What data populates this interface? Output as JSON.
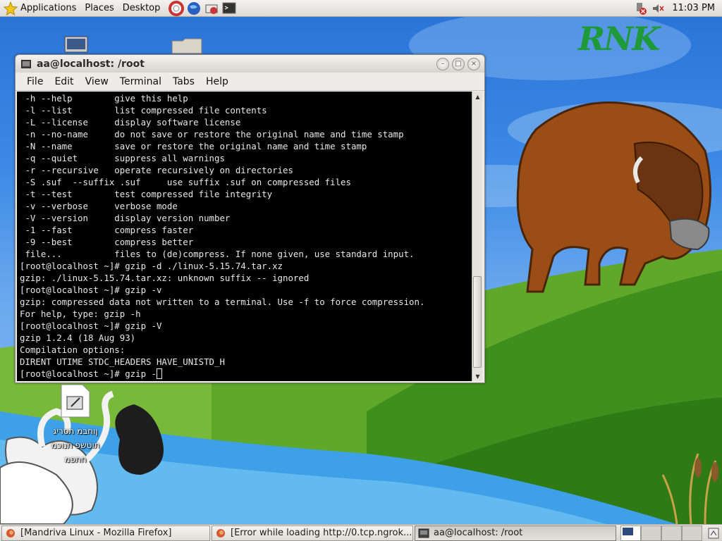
{
  "top_panel": {
    "menus": [
      "Applications",
      "Places",
      "Desktop"
    ],
    "launchers": [
      "help-icon",
      "web-browser-icon",
      "mail-icon",
      "terminal-icon"
    ],
    "clock": "11:03 PM",
    "tray": [
      "network-icon",
      "volume-muted-icon"
    ]
  },
  "desktop": {
    "logo_text": "RNK",
    "icons": [
      {
        "name": "computer-icon",
        "label": ""
      },
      {
        "name": "folder-icon",
        "label": ""
      },
      {
        "name": "document-icon",
        "label": "ןוחבמ תסריג\nתוטשפ תנוכמ\nחתפמ"
      }
    ]
  },
  "terminal": {
    "title": "aa@localhost: /root",
    "menu": [
      "File",
      "Edit",
      "View",
      "Terminal",
      "Tabs",
      "Help"
    ],
    "lines": [
      " -h --help        give this help",
      " -l --list        list compressed file contents",
      " -L --license     display software license",
      " -n --no-name     do not save or restore the original name and time stamp",
      " -N --name        save or restore the original name and time stamp",
      " -q --quiet       suppress all warnings",
      " -r --recursive   operate recursively on directories",
      " -S .suf  --suffix .suf     use suffix .suf on compressed files",
      " -t --test        test compressed file integrity",
      " -v --verbose     verbose mode",
      " -V --version     display version number",
      " -1 --fast        compress faster",
      " -9 --best        compress better",
      " file...          files to (de)compress. If none given, use standard input.",
      "[root@localhost ~]# gzip -d ./linux-5.15.74.tar.xz",
      "gzip: ./linux-5.15.74.tar.xz: unknown suffix -- ignored",
      "[root@localhost ~]# gzip -v",
      "gzip: compressed data not written to a terminal. Use -f to force compression.",
      "For help, type: gzip -h",
      "[root@localhost ~]# gzip -V",
      "gzip 1.2.4 (18 Aug 93)",
      "Compilation options:",
      "DIRENT UTIME STDC_HEADERS HAVE_UNISTD_H"
    ],
    "prompt_line": "[root@localhost ~]# gzip -",
    "scroll_position": 0.98
  },
  "taskbar": {
    "tasks": [
      {
        "label": "[Mandriva Linux - Mozilla Firefox]",
        "icon": "firefox-icon"
      },
      {
        "label": "[Error while loading http://0.tcp.ngrok...",
        "icon": "firefox-icon"
      },
      {
        "label": "aa@localhost: /root",
        "icon": "terminal-icon"
      }
    ],
    "workspaces": 4,
    "active_workspace": 1
  },
  "colors": {
    "terminal_bg": "#000000",
    "terminal_fg": "#e8e8e8",
    "logo": "#1f9a3a"
  }
}
